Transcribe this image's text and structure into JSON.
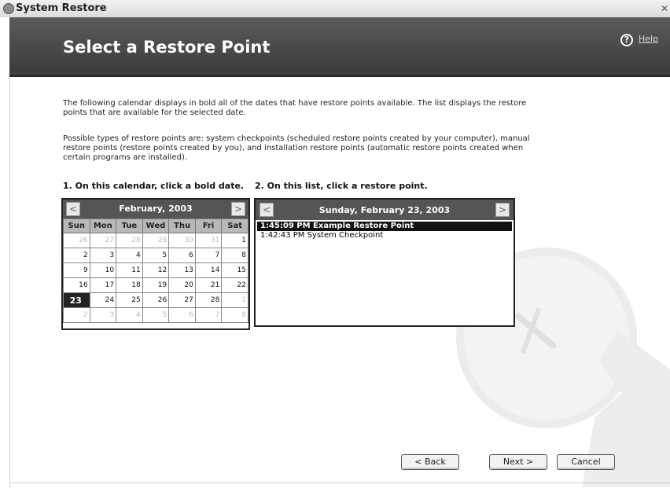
{
  "window": {
    "title": "System Restore"
  },
  "header": {
    "title": "Select a Restore Point",
    "help_label": "Help"
  },
  "intro": {
    "para1": "The following calendar displays in bold all of the dates that have restore points available. The list displays the restore points that are available for the selected date.",
    "para2": "Possible types of restore points are: system checkpoints (scheduled restore points created by your computer), manual restore points (restore points created by you), and installation restore points (automatic restore points created when certain programs are installed)."
  },
  "steps": {
    "step1": "1. On this calendar, click a bold date.",
    "step2": "2. On this list, click a restore point."
  },
  "calendar": {
    "month_title": "February, 2003",
    "prev_glyph": "<",
    "next_glyph": ">",
    "weekdays": [
      "Sun",
      "Mon",
      "Tue",
      "Wed",
      "Thu",
      "Fri",
      "Sat"
    ],
    "weeks": [
      [
        "26",
        "27",
        "28",
        "29",
        "30",
        "31",
        "1"
      ],
      [
        "2",
        "3",
        "4",
        "5",
        "6",
        "7",
        "8"
      ],
      [
        "9",
        "10",
        "11",
        "12",
        "13",
        "14",
        "15"
      ],
      [
        "16",
        "17",
        "18",
        "19",
        "20",
        "21",
        "22"
      ],
      [
        "23",
        "24",
        "25",
        "26",
        "27",
        "28",
        "1"
      ],
      [
        "2",
        "3",
        "4",
        "5",
        "6",
        "7",
        "8"
      ]
    ],
    "selected_date": "23"
  },
  "restore_list": {
    "date_title": "Sunday, February 23, 2003",
    "prev_glyph": "<",
    "next_glyph": ">",
    "items": [
      {
        "time": "1:45:09 PM",
        "name": "Example Restore Point",
        "selected": true
      },
      {
        "time": "1:42:43 PM",
        "name": "System Checkpoint",
        "selected": false
      }
    ]
  },
  "buttons": {
    "back": "< Back",
    "next": "Next >",
    "cancel": "Cancel"
  },
  "icons": {
    "help": "help-circle-icon",
    "title": "system-restore-icon",
    "close": "close-icon"
  }
}
